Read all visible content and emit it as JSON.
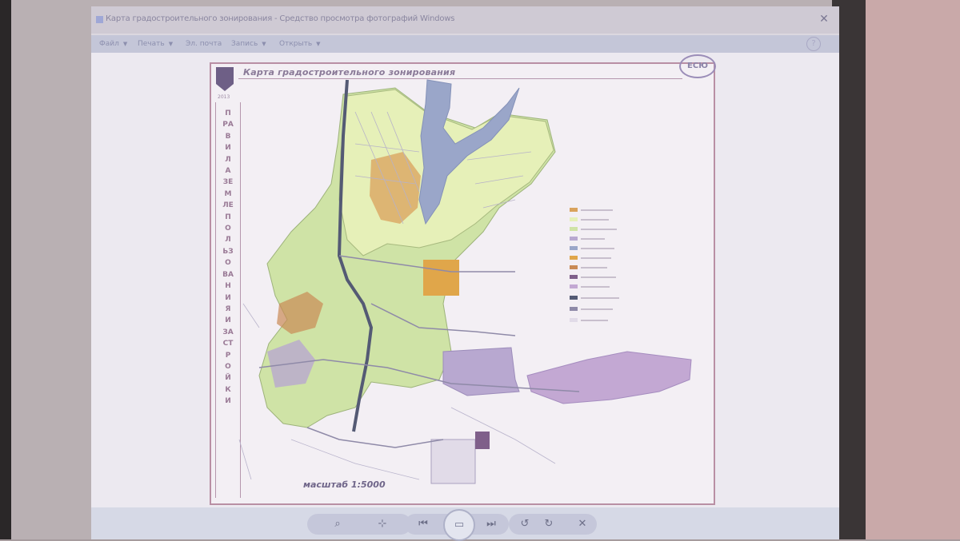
{
  "window": {
    "title": "Карта градостроительного зонирования - Средство просмотра фотографий Windows",
    "close_glyph": "✕"
  },
  "menu": {
    "items": [
      {
        "label": "Файл"
      },
      {
        "label": "Печать"
      },
      {
        "label": "Эл. почта"
      },
      {
        "label": "Запись"
      },
      {
        "label": "Открыть"
      }
    ],
    "help_glyph": "?"
  },
  "document": {
    "title": "Карта градостроительного зонирования",
    "year": "2013",
    "vertical_text": "ПРАВИЛА ЗЕМЛЕПОЛЬЗОВАНИЯ И ЗАСТРОЙКИ",
    "scale": "масштаб 1:5000",
    "logo_text": "ЕСЮ"
  },
  "controls": {
    "zoom_glyph": "⌕",
    "fit_glyph": "⊹",
    "prev_glyph": "⏮",
    "slideshow_glyph": "▭",
    "next_glyph": "⏭",
    "rotate_left_glyph": "↺",
    "rotate_right_glyph": "↻",
    "delete_glyph": "✕"
  },
  "colors": {
    "residential": "#d9a25c",
    "green_zone": "#cfe3a6",
    "light_green": "#e6f0b8",
    "water": "#9aa6c9",
    "industrial": "#b8a8d0",
    "orange_block": "#e0a64a"
  }
}
